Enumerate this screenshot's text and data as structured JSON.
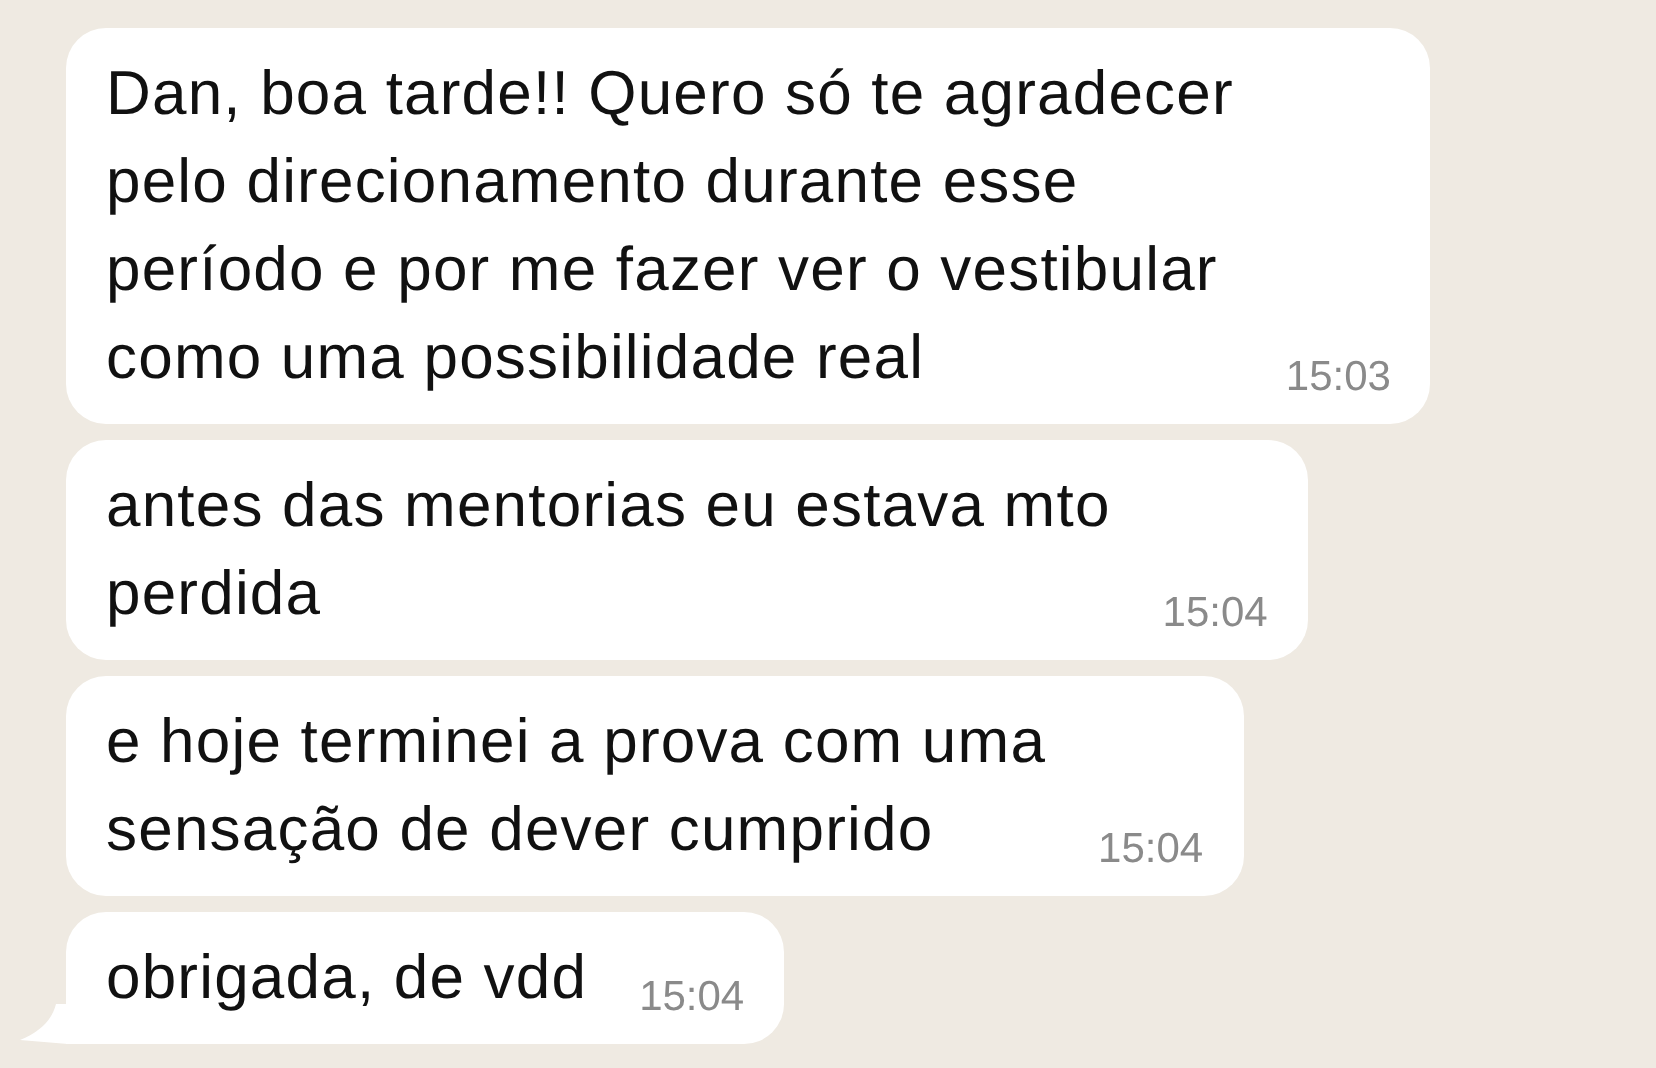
{
  "messages": [
    {
      "lines": [
        "Dan, boa tarde!! Quero só te agradecer",
        "pelo direcionamento durante esse",
        "período e por me fazer ver o vestibular",
        "como uma possibilidade real"
      ],
      "time": "15:03",
      "tail": false
    },
    {
      "lines": [
        "antes das mentorias eu estava mto",
        "perdida"
      ],
      "time": "15:04",
      "tail": false
    },
    {
      "lines": [
        "e hoje terminei a prova com uma",
        "sensação de dever cumprido"
      ],
      "time": "15:04",
      "tail": false
    },
    {
      "lines": [
        "obrigada, de vdd"
      ],
      "time": "15:04",
      "tail": true
    }
  ]
}
